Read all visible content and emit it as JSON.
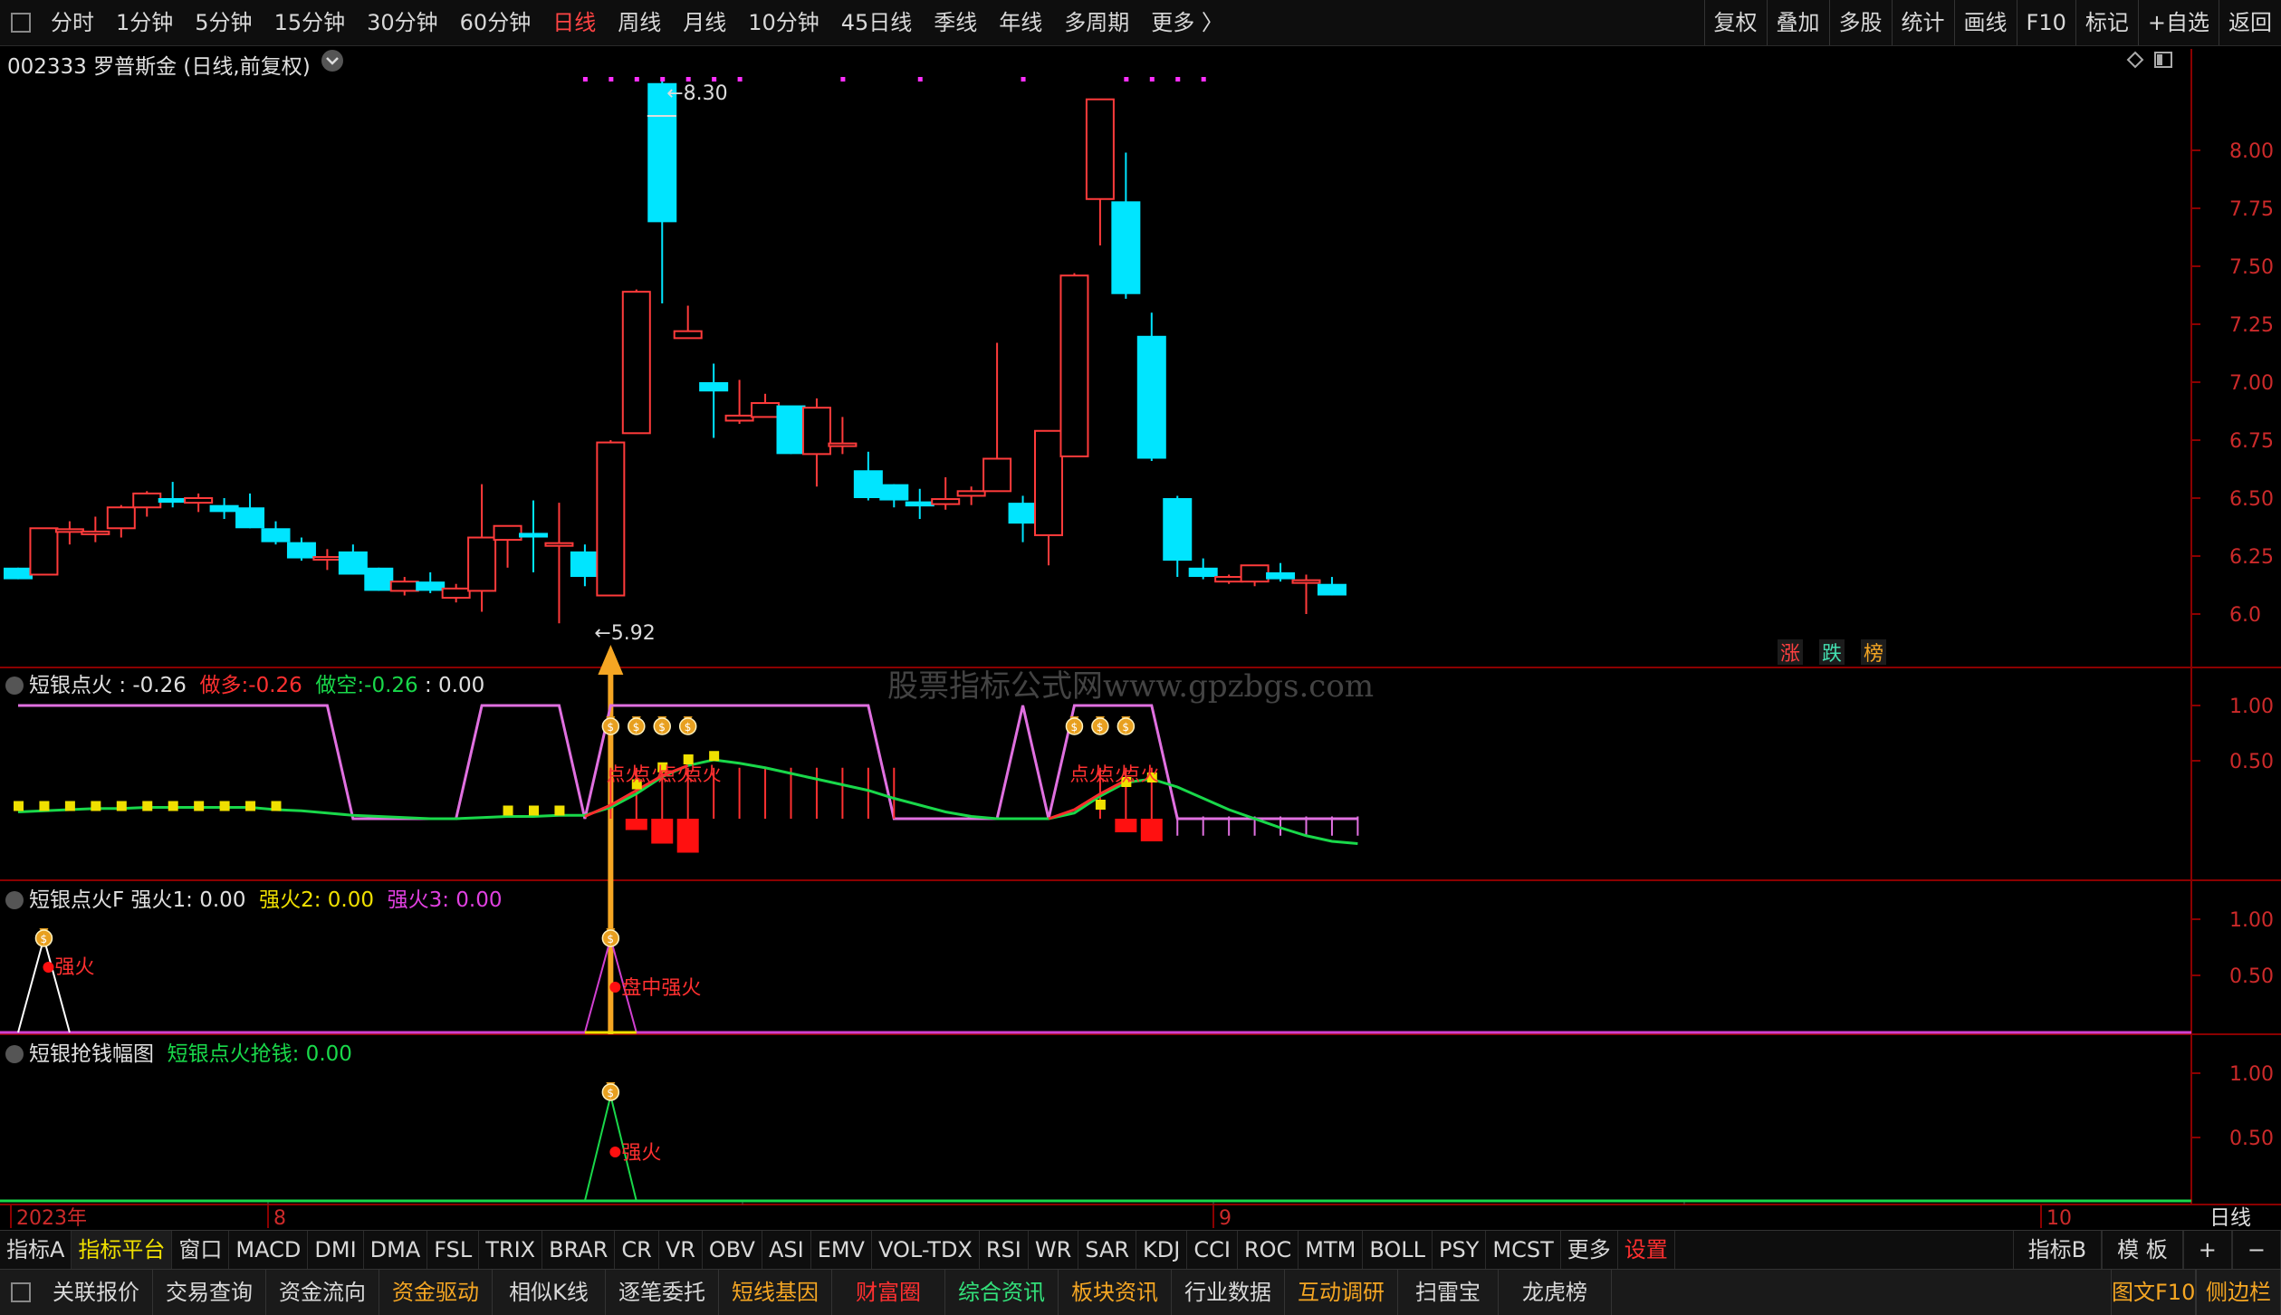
{
  "top_toolbar": {
    "periods": [
      "分时",
      "1分钟",
      "5分钟",
      "15分钟",
      "30分钟",
      "60分钟",
      "日线",
      "周线",
      "月线",
      "10分钟",
      "45日线",
      "季线",
      "年线",
      "多周期",
      "更多 〉"
    ],
    "active_period": "日线",
    "right_buttons": [
      "复权",
      "叠加",
      "多股",
      "统计",
      "画线",
      "F10",
      "标记",
      "+自选",
      "返回"
    ]
  },
  "main_chart": {
    "title": "002333 罗普斯金 (日线,前复权)",
    "high_marker": "8.30",
    "low_marker": "5.92",
    "badges": [
      "涨",
      "跌",
      "榜"
    ]
  },
  "watermark": "股票指标公式网www.gpzbgs.com",
  "panels": {
    "p1": {
      "name": "短银点火",
      "name_value": ": -0.26",
      "long_label": "做多:",
      "long_value": "-0.26",
      "short_label": "做空:",
      "short_value": "-0.26",
      "extra": ": 0.00",
      "signal_text": "点火"
    },
    "p2": {
      "name": "短银点火F",
      "f1": "强火1: 0.00",
      "f2": "强火2: 0.00",
      "f3": "强火3: 0.00",
      "label_a": "强火",
      "label_b": "盘中强火"
    },
    "p3": {
      "name": "短银抢钱幅图",
      "val": "短银点火抢钱: 0.00",
      "label_a": "强火"
    }
  },
  "axis": {
    "price_ticks": [
      "8.00",
      "7.75",
      "7.50",
      "7.25",
      "7.00",
      "6.75",
      "6.50",
      "6.25",
      "6.0"
    ],
    "ind_ticks": [
      "1.00",
      "0.50"
    ],
    "dates": [
      "2023年",
      "8",
      "9",
      "10"
    ],
    "period_label": "日线"
  },
  "indicator_tabs": {
    "items": [
      "指标A",
      "指标平台",
      "窗口",
      "MACD",
      "DMI",
      "DMA",
      "FSL",
      "TRIX",
      "BRAR",
      "CR",
      "VR",
      "OBV",
      "ASI",
      "EMV",
      "VOL-TDX",
      "RSI",
      "WR",
      "SAR",
      "KDJ",
      "CCI",
      "ROC",
      "MTM",
      "BOLL",
      "PSY",
      "MCST",
      "更多",
      "设置"
    ],
    "right": [
      "指标B",
      "模 板",
      "+",
      "−"
    ]
  },
  "bottom_toolbar": {
    "items": [
      "关联报价",
      "交易查询",
      "资金流向",
      "资金驱动",
      "相似K线",
      "逐笔委托",
      "短线基因",
      "财富圈",
      "综合资讯",
      "板块资讯",
      "行业数据",
      "互动调研",
      "扫雷宝",
      "龙虎榜"
    ],
    "right": [
      "图文F10",
      "侧边栏"
    ]
  },
  "colors": {
    "up": "#ff3b3b",
    "down": "#00e5ff",
    "accent_orange": "#f5a623",
    "long": "#ff2d2d",
    "short": "#19d84a",
    "pink": "#e070e0",
    "yellow": "#f0e000",
    "tab_orange": "#f5a623",
    "tab_green": "#33e07a",
    "tab_red": "#ff3030"
  },
  "candles": [
    {
      "o": 6.2,
      "h": 6.2,
      "l": 6.15,
      "c": 6.15
    },
    {
      "o": 6.17,
      "h": 6.37,
      "l": 6.17,
      "c": 6.37
    },
    {
      "o": 6.36,
      "h": 6.4,
      "l": 6.3,
      "c": 6.36
    },
    {
      "o": 6.35,
      "h": 6.42,
      "l": 6.31,
      "c": 6.35
    },
    {
      "o": 6.37,
      "h": 6.47,
      "l": 6.33,
      "c": 6.46
    },
    {
      "o": 6.46,
      "h": 6.53,
      "l": 6.42,
      "c": 6.52
    },
    {
      "o": 6.5,
      "h": 6.57,
      "l": 6.46,
      "c": 6.48
    },
    {
      "o": 6.48,
      "h": 6.52,
      "l": 6.44,
      "c": 6.5
    },
    {
      "o": 6.47,
      "h": 6.5,
      "l": 6.41,
      "c": 6.44
    },
    {
      "o": 6.46,
      "h": 6.52,
      "l": 6.37,
      "c": 6.37
    },
    {
      "o": 6.37,
      "h": 6.4,
      "l": 6.3,
      "c": 6.31
    },
    {
      "o": 6.31,
      "h": 6.33,
      "l": 6.23,
      "c": 6.24
    },
    {
      "o": 6.24,
      "h": 6.28,
      "l": 6.19,
      "c": 6.24
    },
    {
      "o": 6.27,
      "h": 6.3,
      "l": 6.17,
      "c": 6.17
    },
    {
      "o": 6.2,
      "h": 6.2,
      "l": 6.1,
      "c": 6.1
    },
    {
      "o": 6.1,
      "h": 6.16,
      "l": 6.08,
      "c": 6.14
    },
    {
      "o": 6.14,
      "h": 6.18,
      "l": 6.09,
      "c": 6.1
    },
    {
      "o": 6.07,
      "h": 6.13,
      "l": 6.05,
      "c": 6.11
    },
    {
      "o": 6.1,
      "h": 6.56,
      "l": 6.01,
      "c": 6.33
    },
    {
      "o": 6.32,
      "h": 6.38,
      "l": 6.2,
      "c": 6.38
    },
    {
      "o": 6.35,
      "h": 6.49,
      "l": 6.18,
      "c": 6.33
    },
    {
      "o": 6.3,
      "h": 6.48,
      "l": 5.96,
      "c": 6.3
    },
    {
      "o": 6.27,
      "h": 6.3,
      "l": 6.12,
      "c": 6.16
    },
    {
      "o": 6.08,
      "h": 6.75,
      "l": 6.08,
      "c": 6.74
    },
    {
      "o": 6.78,
      "h": 7.4,
      "l": 6.78,
      "c": 7.39
    },
    {
      "o": 8.29,
      "h": 8.3,
      "l": 7.34,
      "c": 7.69
    },
    {
      "o": 7.19,
      "h": 7.33,
      "l": 7.19,
      "c": 7.22
    },
    {
      "o": 7.0,
      "h": 7.08,
      "l": 6.76,
      "c": 6.96
    },
    {
      "o": 6.84,
      "h": 7.01,
      "l": 6.82,
      "c": 6.85
    },
    {
      "o": 6.85,
      "h": 6.95,
      "l": 6.85,
      "c": 6.91
    },
    {
      "o": 6.9,
      "h": 6.89,
      "l": 6.69,
      "c": 6.69
    },
    {
      "o": 6.69,
      "h": 6.93,
      "l": 6.55,
      "c": 6.89
    },
    {
      "o": 6.73,
      "h": 6.85,
      "l": 6.69,
      "c": 6.73
    },
    {
      "o": 6.62,
      "h": 6.7,
      "l": 6.49,
      "c": 6.5
    },
    {
      "o": 6.56,
      "h": 6.56,
      "l": 6.46,
      "c": 6.49
    },
    {
      "o": 6.48,
      "h": 6.54,
      "l": 6.41,
      "c": 6.47
    },
    {
      "o": 6.48,
      "h": 6.59,
      "l": 6.45,
      "c": 6.49
    },
    {
      "o": 6.51,
      "h": 6.55,
      "l": 6.47,
      "c": 6.53
    },
    {
      "o": 6.53,
      "h": 7.17,
      "l": 6.53,
      "c": 6.67
    },
    {
      "o": 6.48,
      "h": 6.51,
      "l": 6.31,
      "c": 6.39
    },
    {
      "o": 6.34,
      "h": 6.78,
      "l": 6.21,
      "c": 6.79
    },
    {
      "o": 6.68,
      "h": 7.47,
      "l": 6.68,
      "c": 7.46
    },
    {
      "o": 7.79,
      "h": 8.22,
      "l": 7.59,
      "c": 8.22
    },
    {
      "o": 7.78,
      "h": 7.99,
      "l": 7.36,
      "c": 7.38
    },
    {
      "o": 7.2,
      "h": 7.3,
      "l": 6.66,
      "c": 6.67
    },
    {
      "o": 6.5,
      "h": 6.51,
      "l": 6.16,
      "c": 6.23
    },
    {
      "o": 6.2,
      "h": 6.24,
      "l": 6.15,
      "c": 6.16
    },
    {
      "o": 6.14,
      "h": 6.17,
      "l": 6.13,
      "c": 6.16
    },
    {
      "o": 6.14,
      "h": 6.21,
      "l": 6.12,
      "c": 6.21
    },
    {
      "o": 6.18,
      "h": 6.22,
      "l": 6.14,
      "c": 6.15
    },
    {
      "o": 6.14,
      "h": 6.17,
      "l": 6.0,
      "c": 6.14
    },
    {
      "o": 6.13,
      "h": 6.16,
      "l": 6.08,
      "c": 6.08
    }
  ]
}
